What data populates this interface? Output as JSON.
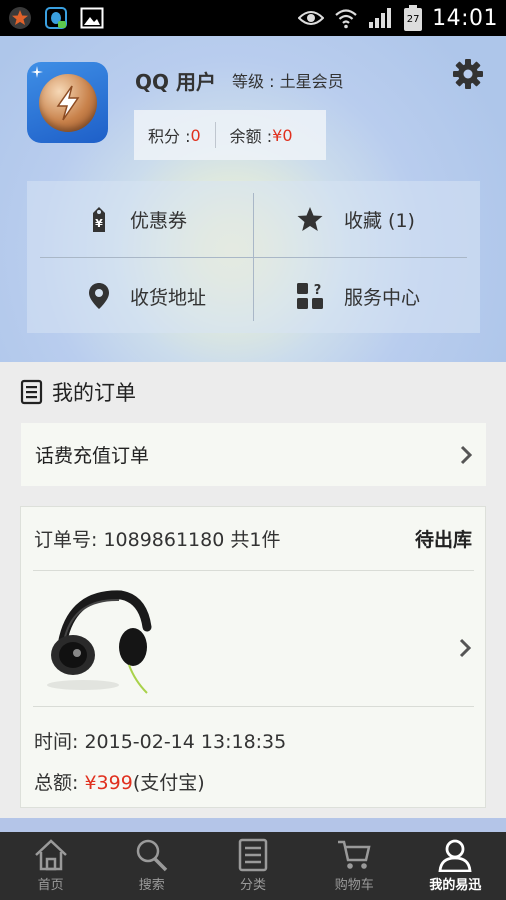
{
  "status_bar": {
    "time": "14:01",
    "battery_level": "27"
  },
  "profile": {
    "user_name": "QQ 用户",
    "level_text": "等级 : 土星会员",
    "points_label": "积分 : ",
    "points_value": "0",
    "balance_label": "余额 : ",
    "balance_value": "¥0",
    "menu": [
      {
        "label": "优惠券",
        "icon": "coupon-tag-icon"
      },
      {
        "label": "收藏 (1)",
        "icon": "star-icon"
      },
      {
        "label": "收货地址",
        "icon": "map-pin-icon"
      },
      {
        "label": "服务中心",
        "icon": "service-grid-icon"
      }
    ]
  },
  "orders": {
    "title": "我的订单",
    "recharge_label": "话费充值订单",
    "card": {
      "order_number": "订单号: 1089861180 共1件",
      "status": "待出库",
      "time": "时间: 2015-02-14 13:18:35",
      "total_label": "总额: ",
      "total_price": "¥399",
      "payment": "(支付宝)"
    }
  },
  "bottom_nav": [
    {
      "label": "首页",
      "icon": "home-icon",
      "active": false
    },
    {
      "label": "搜索",
      "icon": "search-icon",
      "active": false
    },
    {
      "label": "分类",
      "icon": "category-list-icon",
      "active": false
    },
    {
      "label": "购物车",
      "icon": "cart-icon",
      "active": false
    },
    {
      "label": "我的易迅",
      "icon": "user-icon",
      "active": true
    }
  ],
  "colors": {
    "accent_red": "#e0301e",
    "nav_bg": "#2d2d2d",
    "header_bg": "#aec6ea"
  }
}
